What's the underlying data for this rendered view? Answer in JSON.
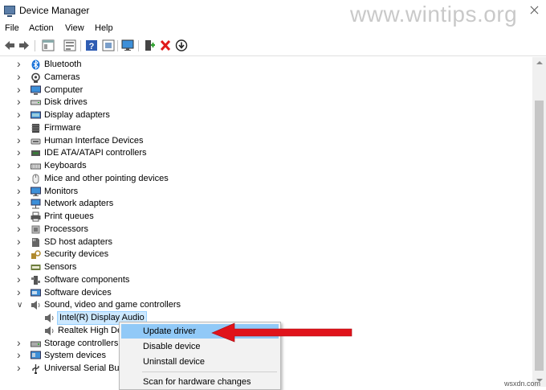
{
  "window": {
    "title": "Device Manager",
    "watermark": "www.wintips.org",
    "site_mark": "wsxdn.com"
  },
  "menu": [
    "File",
    "Action",
    "View",
    "Help"
  ],
  "toolbar": [
    "back-icon",
    "forward-icon",
    "properties-icon",
    "help-icon",
    "show-hide-icon",
    "monitor-icon",
    "update-driver-icon",
    "uninstall-icon",
    "download-icon"
  ],
  "tree": [
    {
      "label": "Bluetooth",
      "icon": "bluetooth-icon",
      "color": "#1a73d9"
    },
    {
      "label": "Cameras",
      "icon": "camera-icon",
      "color": "#444444"
    },
    {
      "label": "Computer",
      "icon": "computer-icon",
      "color": "#3d8fd8"
    },
    {
      "label": "Disk drives",
      "icon": "disk-icon",
      "color": "#555555"
    },
    {
      "label": "Display adapters",
      "icon": "display-icon",
      "color": "#3d8fd8"
    },
    {
      "label": "Firmware",
      "icon": "firmware-icon",
      "color": "#444444"
    },
    {
      "label": "Human Interface Devices",
      "icon": "hid-icon",
      "color": "#666666"
    },
    {
      "label": "IDE ATA/ATAPI controllers",
      "icon": "ide-icon",
      "color": "#3a7a3a"
    },
    {
      "label": "Keyboards",
      "icon": "keyboard-icon",
      "color": "#555555"
    },
    {
      "label": "Mice and other pointing devices",
      "icon": "mouse-icon",
      "color": "#777777"
    },
    {
      "label": "Monitors",
      "icon": "monitor-icon",
      "color": "#3d8fd8"
    },
    {
      "label": "Network adapters",
      "icon": "network-icon",
      "color": "#3d8fd8"
    },
    {
      "label": "Print queues",
      "icon": "printer-icon",
      "color": "#555555"
    },
    {
      "label": "Processors",
      "icon": "processor-icon",
      "color": "#777777"
    },
    {
      "label": "SD host adapters",
      "icon": "sd-card-icon",
      "color": "#666666"
    },
    {
      "label": "Security devices",
      "icon": "security-icon",
      "color": "#b08a2e"
    },
    {
      "label": "Sensors",
      "icon": "sensor-icon",
      "color": "#6c7d3c"
    },
    {
      "label": "Software components",
      "icon": "software-component-icon",
      "color": "#555555"
    },
    {
      "label": "Software devices",
      "icon": "software-device-icon",
      "color": "#3d8fd8"
    },
    {
      "label": "Sound, video and game controllers",
      "icon": "speaker-icon",
      "color": "#666666",
      "expanded": true
    },
    {
      "label": "Intel(R) Display Audio",
      "icon": "speaker-icon",
      "color": "#666666",
      "child": true,
      "selected": true
    },
    {
      "label": "Realtek High Def",
      "icon": "speaker-icon",
      "color": "#666666",
      "child": true
    },
    {
      "label": "Storage controllers",
      "icon": "storage-icon",
      "color": "#555555"
    },
    {
      "label": "System devices",
      "icon": "system-icon",
      "color": "#3d8fd8"
    },
    {
      "label": "Universal Serial Bus c",
      "icon": "usb-icon",
      "color": "#333333"
    }
  ],
  "context_menu": {
    "items": [
      "Update driver",
      "Disable device",
      "Uninstall device",
      "Scan for hardware changes"
    ],
    "highlighted": 0
  },
  "colors": {
    "selection": "#cce8ff",
    "menu_highlight": "#91c9f7",
    "arrow": "#e0131b"
  }
}
